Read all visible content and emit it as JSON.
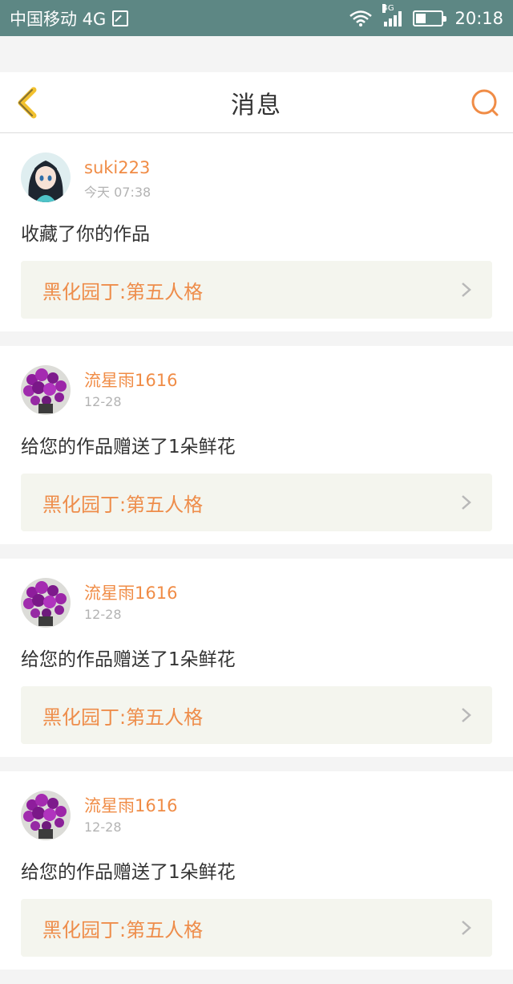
{
  "status_bar": {
    "carrier": "中国移动 4G",
    "network_tag": "4G",
    "time": "20:18"
  },
  "header": {
    "title": "消息",
    "back_icon": "chevron-left-icon",
    "search_icon": "search-icon"
  },
  "colors": {
    "accent": "#f08c46",
    "status_bar": "#5d8784",
    "link_bg": "#f4f5ee"
  },
  "messages": [
    {
      "username": "suki223",
      "time": "今天 07:38",
      "content": "收藏了你的作品",
      "work_title": "黑化园丁:第五人格",
      "avatar": "anime-girl-avatar"
    },
    {
      "username": "流星雨1616",
      "time": "12-28",
      "content": "给您的作品赠送了1朵鲜花",
      "work_title": "黑化园丁:第五人格",
      "avatar": "purple-flowers-avatar"
    },
    {
      "username": "流星雨1616",
      "time": "12-28",
      "content": "给您的作品赠送了1朵鲜花",
      "work_title": "黑化园丁:第五人格",
      "avatar": "purple-flowers-avatar"
    },
    {
      "username": "流星雨1616",
      "time": "12-28",
      "content": "给您的作品赠送了1朵鲜花",
      "work_title": "黑化园丁:第五人格",
      "avatar": "purple-flowers-avatar"
    }
  ]
}
